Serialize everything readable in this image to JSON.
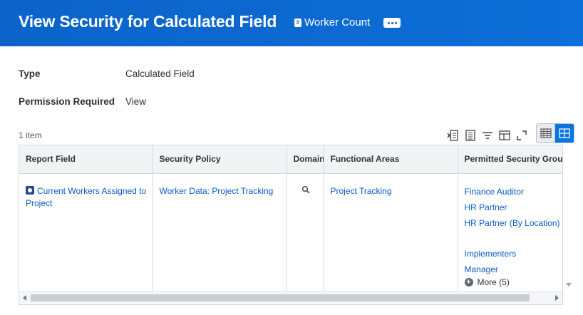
{
  "header": {
    "title": "View Security for Calculated Field",
    "object_chip": {
      "icon": "hash-icon",
      "hash_glyph": "#",
      "label": "Worker Count"
    },
    "more_button_icon": "ellipsis-icon",
    "background_color": "#0b63c9"
  },
  "fields": [
    {
      "label": "Type",
      "value": "Calculated Field"
    },
    {
      "label": "Permission Required",
      "value": "View"
    }
  ],
  "grid": {
    "item_count": "1 item",
    "toolbar_icons": [
      "export-excel-icon",
      "export-pdf-icon",
      "filter-icon",
      "column-config-icon",
      "fullscreen-icon"
    ],
    "view_toggle": {
      "options": [
        "table-view-icon",
        "grid-view-icon"
      ],
      "selected": "grid-view-icon"
    },
    "columns": [
      "Report Field",
      "Security Policy",
      "Domain",
      "Functional Areas",
      "Permitted Security Groups"
    ],
    "rows": [
      {
        "report_field": "Current Workers Assigned to Project",
        "security_policy": "Worker Data: Project Tracking",
        "domain_icon": "search-icon",
        "functional_areas": "Project Tracking",
        "permitted_groups": [
          "Finance Auditor",
          "HR Partner",
          "HR Partner (By Location)",
          "",
          "Implementers",
          "Manager"
        ],
        "more_label": "More (5)"
      }
    ]
  },
  "colors": {
    "link": "#0b5bc4",
    "accent": "#0875e1"
  }
}
